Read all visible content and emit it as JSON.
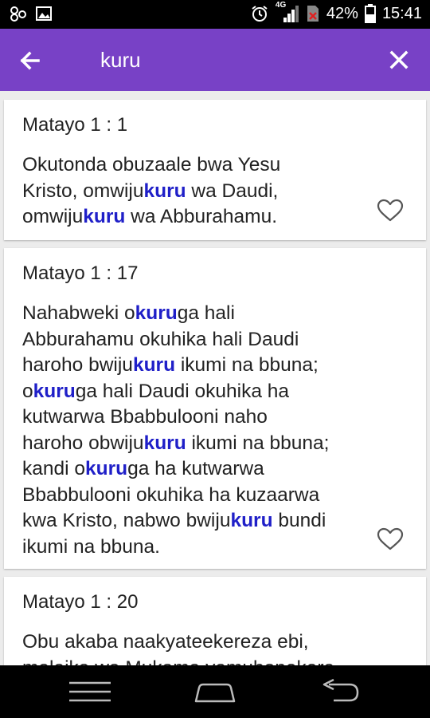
{
  "status_bar": {
    "network": "4G",
    "battery": "42%",
    "time": "15:41"
  },
  "search": {
    "query": "kuru"
  },
  "results": [
    {
      "ref": "Matayo 1 : 1",
      "lines": [
        [
          [
            "Okutonda obuzaale bwa Yesu",
            false
          ]
        ],
        [
          [
            "Kristo, omwiju",
            false
          ],
          [
            "kuru",
            true
          ],
          [
            " wa Daudi,",
            false
          ]
        ],
        [
          [
            "omwiju",
            false
          ],
          [
            "kuru",
            true
          ],
          [
            " wa Abburahamu.",
            false
          ]
        ]
      ]
    },
    {
      "ref": "Matayo 1 : 17",
      "lines": [
        [
          [
            "Nahabweki o",
            false
          ],
          [
            "kuru",
            true
          ],
          [
            "ga hali",
            false
          ]
        ],
        [
          [
            "Abburahamu okuhika hali Daudi",
            false
          ]
        ],
        [
          [
            "haroho bwiju",
            false
          ],
          [
            "kuru",
            true
          ],
          [
            " ikumi na bbuna;",
            false
          ]
        ],
        [
          [
            "o",
            false
          ],
          [
            "kuru",
            true
          ],
          [
            "ga hali Daudi okuhika ha",
            false
          ]
        ],
        [
          [
            "kutwarwa Bbabbulooni naho",
            false
          ]
        ],
        [
          [
            "haroho obwiju",
            false
          ],
          [
            "kuru",
            true
          ],
          [
            " ikumi na bbuna;",
            false
          ]
        ],
        [
          [
            "kandi o",
            false
          ],
          [
            "kuru",
            true
          ],
          [
            "ga ha kutwarwa",
            false
          ]
        ],
        [
          [
            "Bbabbulooni okuhika ha kuzaarwa",
            false
          ]
        ],
        [
          [
            "kwa Kristo, nabwo bwiju",
            false
          ],
          [
            "kuru",
            true
          ],
          [
            " bundi",
            false
          ]
        ],
        [
          [
            "ikumi na bbuna.",
            false
          ]
        ]
      ]
    },
    {
      "ref": "Matayo 1 : 20",
      "lines": [
        [
          [
            "Obu akaba naakyateekereza ebi,",
            false
          ]
        ],
        [
          [
            "malaika wa Mukama yamubonekera",
            false
          ]
        ]
      ]
    }
  ],
  "colors": {
    "app_bar": "#7841c6",
    "highlight": "#1f1fc8"
  },
  "icons": {
    "back": "arrow-left",
    "close": "close-x",
    "favorite": "heart-outline"
  }
}
